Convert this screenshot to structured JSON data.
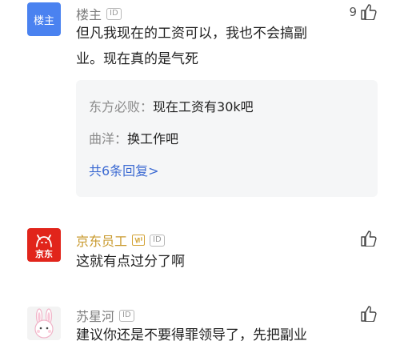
{
  "comments": [
    {
      "avatar_text": "楼主",
      "name": "楼主",
      "id_badge": "ID",
      "likes": "9",
      "text_line1": "但凡我现在的工资可以，我也不会搞副",
      "text_line2": "业。现在真的是气死",
      "replies": [
        {
          "name": "东方必败：",
          "text": "现在工资有30k吧"
        },
        {
          "name": "曲洋：",
          "text": "换工作吧"
        }
      ],
      "more_replies": "共6条回复>"
    },
    {
      "avatar_text": "京东",
      "name": "京东员工",
      "id_badge": "ID",
      "text": "这就有点过分了啊"
    },
    {
      "name": "苏星河",
      "id_badge": "ID",
      "text": "建议你还是不要得罪领导了，先把副业"
    }
  ],
  "icons": {
    "like": "thumbs-up-icon",
    "vip": "vip-badge-icon",
    "jd_logo": "jd-dog-icon",
    "bunny": "bunny-avatar-icon"
  },
  "colors": {
    "louzhu_avatar": "#4a82f0",
    "jd_red": "#e1251b",
    "gold_name": "#c99a2e",
    "link_blue": "#3c6ad2",
    "reply_bg": "#f5f6f7"
  }
}
